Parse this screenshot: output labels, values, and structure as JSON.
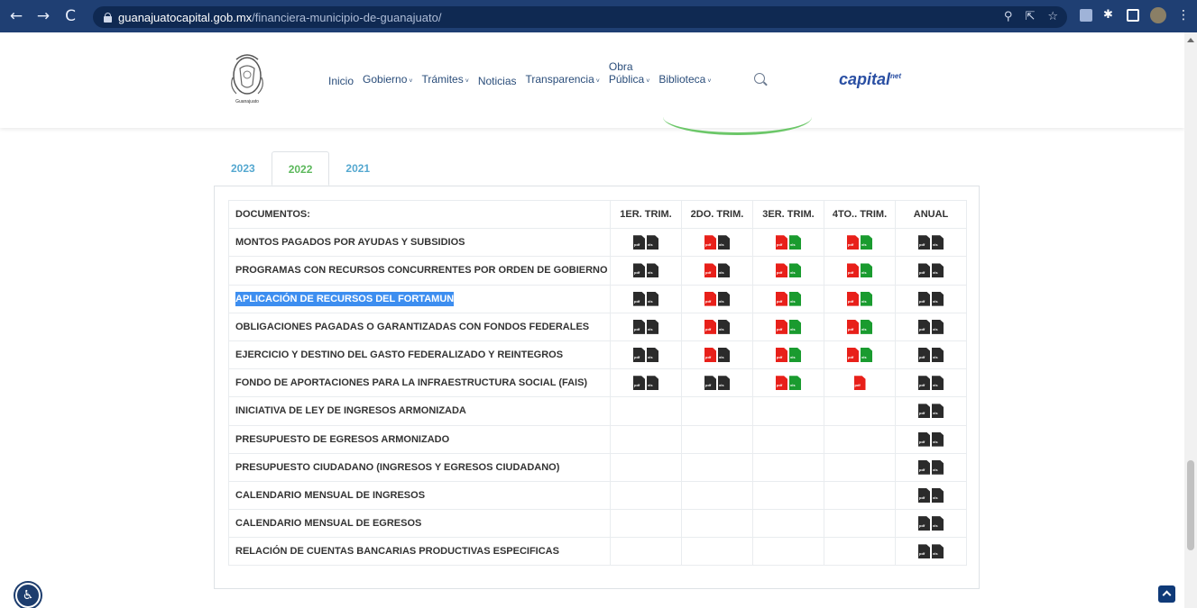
{
  "browser": {
    "back": "←",
    "forward": "→",
    "reload": "C",
    "url_host": "guanajuatocapital.gob.mx",
    "url_path": "/financiera-municipio-de-guanajuato/"
  },
  "header": {
    "logo_text": "Guanajuato",
    "menu": [
      {
        "label": "Inicio",
        "chevron": ""
      },
      {
        "label": "Gobierno",
        "chevron": "˅"
      },
      {
        "label": "Trámites",
        "chevron": "˅"
      },
      {
        "label": "Noticias",
        "chevron": ""
      },
      {
        "label": "Transparencia",
        "chevron": "˅"
      },
      {
        "label": "Obra",
        "label2": "Pública",
        "chevron": "˅"
      },
      {
        "label": "Biblioteca",
        "chevron": "˅"
      }
    ],
    "brand": "capital",
    "brand_sup": "net"
  },
  "tabs": [
    "2023",
    "2022",
    "2021"
  ],
  "active_tab": "2022",
  "table": {
    "headers": [
      "DOCUMENTOS:",
      "1ER. TRIM.",
      "2DO. TRIM.",
      "3ER. TRIM.",
      "4TO.. TRIM.",
      "ANUAL"
    ],
    "rows": [
      {
        "label": "MONTOS PAGADOS POR AYUDAS Y SUBSIDIOS",
        "cells": [
          [
            "black",
            "black"
          ],
          [
            "red",
            "black"
          ],
          [
            "red",
            "green"
          ],
          [
            "red",
            "green"
          ],
          [
            "black",
            "black"
          ]
        ]
      },
      {
        "label": "PROGRAMAS CON RECURSOS CONCURRENTES POR ORDEN DE GOBIERNO",
        "cells": [
          [
            "black",
            "black"
          ],
          [
            "red",
            "black"
          ],
          [
            "red",
            "green"
          ],
          [
            "red",
            "green"
          ],
          [
            "black",
            "black"
          ]
        ]
      },
      {
        "label": "APLICACIÓN DE RECURSOS DEL FORTAMUN",
        "highlight": true,
        "cells": [
          [
            "black",
            "black"
          ],
          [
            "red",
            "black"
          ],
          [
            "red",
            "green"
          ],
          [
            "red",
            "green"
          ],
          [
            "black",
            "black"
          ]
        ]
      },
      {
        "label": "OBLIGACIONES PAGADAS O GARANTIZADAS CON FONDOS FEDERALES",
        "cells": [
          [
            "black",
            "black"
          ],
          [
            "red",
            "black"
          ],
          [
            "red",
            "green"
          ],
          [
            "red",
            "green"
          ],
          [
            "black",
            "black"
          ]
        ]
      },
      {
        "label": "EJERCICIO Y DESTINO DEL GASTO FEDERALIZADO Y REINTEGROS",
        "cells": [
          [
            "black",
            "black"
          ],
          [
            "red",
            "black"
          ],
          [
            "red",
            "green"
          ],
          [
            "red",
            "green"
          ],
          [
            "black",
            "black"
          ]
        ]
      },
      {
        "label": "FONDO DE APORTACIONES PARA LA INFRAESTRUCTURA SOCIAL (FAIS)",
        "cells": [
          [
            "black",
            "black"
          ],
          [
            "black",
            "black"
          ],
          [
            "red",
            "green"
          ],
          [
            "red"
          ],
          [
            "black",
            "black"
          ]
        ]
      },
      {
        "label": "INICIATIVA DE LEY DE INGRESOS ARMONIZADA",
        "cells": [
          [],
          [],
          [],
          [],
          [
            "black",
            "black"
          ]
        ]
      },
      {
        "label": "PRESUPUESTO DE EGRESOS ARMONIZADO",
        "cells": [
          [],
          [],
          [],
          [],
          [
            "black",
            "black"
          ]
        ]
      },
      {
        "label": "PRESUPUESTO CIUDADANO (INGRESOS Y EGRESOS CIUDADANO)",
        "cells": [
          [],
          [],
          [],
          [],
          [
            "black",
            "black"
          ]
        ]
      },
      {
        "label": "CALENDARIO MENSUAL DE INGRESOS",
        "cells": [
          [],
          [],
          [],
          [],
          [
            "black",
            "black"
          ]
        ]
      },
      {
        "label": "CALENDARIO MENSUAL DE EGRESOS",
        "cells": [
          [],
          [],
          [],
          [],
          [
            "black",
            "black"
          ]
        ]
      },
      {
        "label": "RELACIÓN DE CUENTAS BANCARIAS PRODUCTIVAS ESPECIFICAS",
        "cells": [
          [],
          [],
          [],
          [],
          [
            "black",
            "black"
          ]
        ]
      }
    ]
  },
  "icon_labels": {
    "pdf": "pdf",
    "xls": "xls"
  },
  "colors": {
    "pdf_red": "#e8201a",
    "xls_green": "#1a9b2f",
    "icon_black": "#2b2b2b",
    "highlight": "#3d8ef0",
    "tab_active": "#5cb85c",
    "tab_inactive": "#55a8d0"
  }
}
